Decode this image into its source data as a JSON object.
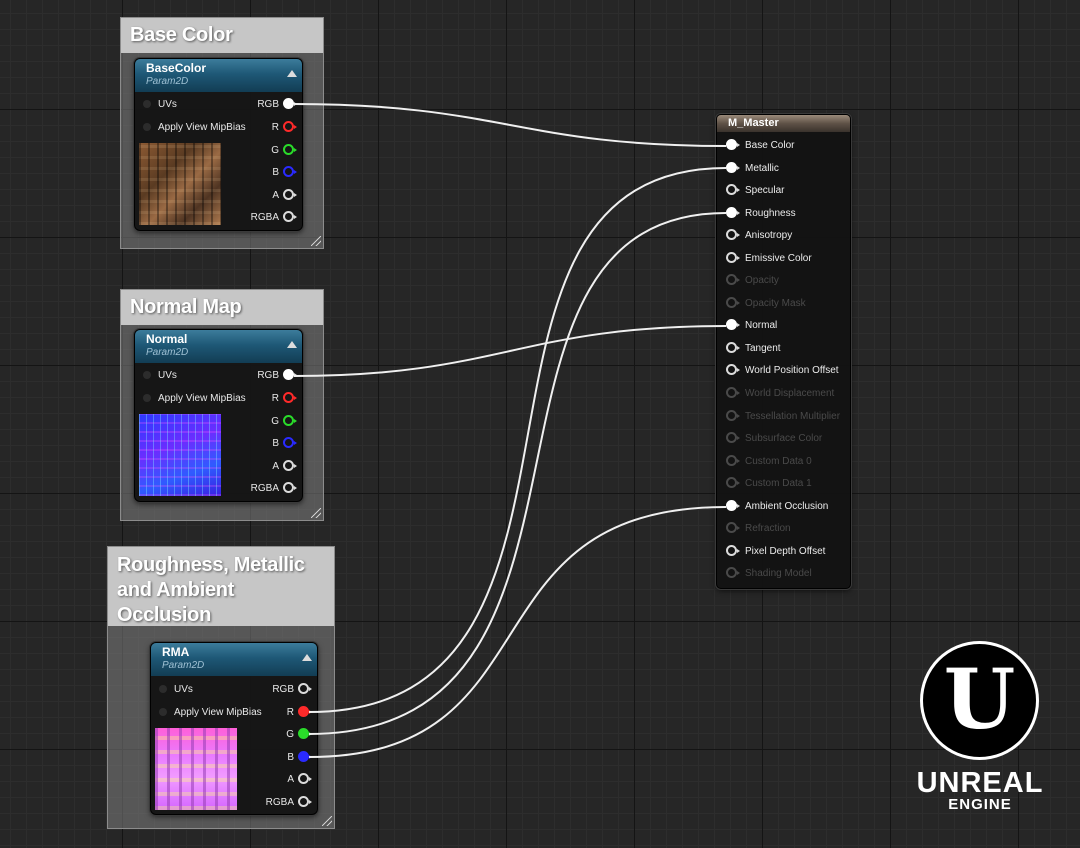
{
  "comments": {
    "base_color": "Base Color",
    "normal_map": "Normal Map",
    "rma": "Roughness, Metallic and Ambient Occlusion"
  },
  "texture_nodes": [
    {
      "title": "BaseColor",
      "subtitle": "Param2D",
      "inputs": [
        "UVs",
        "Apply View MipBias"
      ],
      "outputs": [
        "RGB",
        "R",
        "G",
        "B",
        "A",
        "RGBA"
      ]
    },
    {
      "title": "Normal",
      "subtitle": "Param2D",
      "inputs": [
        "UVs",
        "Apply View MipBias"
      ],
      "outputs": [
        "RGB",
        "R",
        "G",
        "B",
        "A",
        "RGBA"
      ]
    },
    {
      "title": "RMA",
      "subtitle": "Param2D",
      "inputs": [
        "UVs",
        "Apply View MipBias"
      ],
      "outputs": [
        "RGB",
        "R",
        "G",
        "B",
        "A",
        "RGBA"
      ]
    }
  ],
  "master": {
    "title": "M_Master",
    "inputs": [
      {
        "label": "Base Color",
        "connected": true,
        "enabled": true
      },
      {
        "label": "Metallic",
        "connected": true,
        "enabled": true
      },
      {
        "label": "Specular",
        "connected": false,
        "enabled": true
      },
      {
        "label": "Roughness",
        "connected": true,
        "enabled": true
      },
      {
        "label": "Anisotropy",
        "connected": false,
        "enabled": true
      },
      {
        "label": "Emissive Color",
        "connected": false,
        "enabled": true
      },
      {
        "label": "Opacity",
        "connected": false,
        "enabled": false
      },
      {
        "label": "Opacity Mask",
        "connected": false,
        "enabled": false
      },
      {
        "label": "Normal",
        "connected": true,
        "enabled": true
      },
      {
        "label": "Tangent",
        "connected": false,
        "enabled": true
      },
      {
        "label": "World Position Offset",
        "connected": false,
        "enabled": true
      },
      {
        "label": "World Displacement",
        "connected": false,
        "enabled": false
      },
      {
        "label": "Tessellation Multiplier",
        "connected": false,
        "enabled": false
      },
      {
        "label": "Subsurface Color",
        "connected": false,
        "enabled": false
      },
      {
        "label": "Custom Data 0",
        "connected": false,
        "enabled": false
      },
      {
        "label": "Custom Data 1",
        "connected": false,
        "enabled": false
      },
      {
        "label": "Ambient Occlusion",
        "connected": true,
        "enabled": true
      },
      {
        "label": "Refraction",
        "connected": false,
        "enabled": false
      },
      {
        "label": "Pixel Depth Offset",
        "connected": false,
        "enabled": true
      },
      {
        "label": "Shading Model",
        "connected": false,
        "enabled": false
      }
    ]
  },
  "connections": [
    {
      "from": "BaseColor.RGB",
      "to": "Base Color"
    },
    {
      "from": "Normal.RGB",
      "to": "Normal"
    },
    {
      "from": "RMA.R",
      "to": "Metallic"
    },
    {
      "from": "RMA.G",
      "to": "Roughness"
    },
    {
      "from": "RMA.B",
      "to": "Ambient Occlusion"
    }
  ],
  "pin_colors": {
    "R": "#ff2a2a",
    "G": "#2adc2a",
    "B": "#2a2aff",
    "default": "#dcdcdc",
    "wire": "#f0f0f0"
  },
  "icons": {
    "collapse": "collapse-arrow-icon",
    "resize": "resize-grip-icon",
    "texture": "texture-preview-image"
  },
  "logo": {
    "brand": "UNREAL",
    "product": "ENGINE"
  }
}
